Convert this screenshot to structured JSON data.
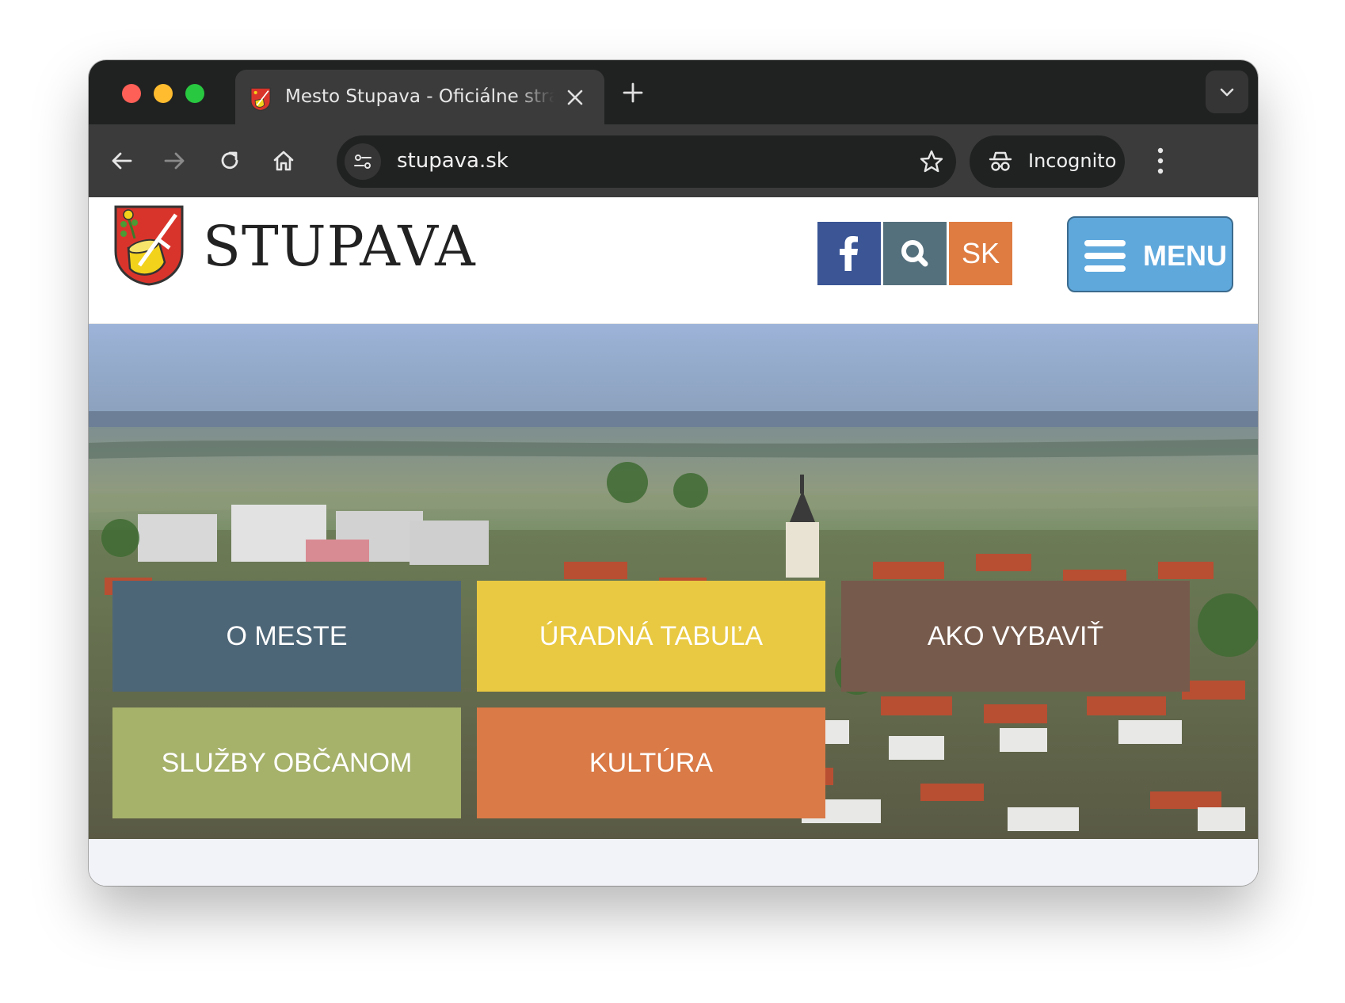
{
  "browser": {
    "tab_title": "Mesto Stupava - Oficiálne stránky mesta",
    "url": "stupava.sk",
    "incognito_label": "Incognito"
  },
  "site": {
    "logo_text": "STUPAVA",
    "lang_label": "SK",
    "menu_label": "MENU"
  },
  "tiles": {
    "o_meste": "O MESTE",
    "uradna_tabula": "ÚRADNÁ TABUĽA",
    "ako_vybavit": "AKO VYBAVIŤ",
    "sluzby_obcanom": "SLUŽBY OBČANOM",
    "kultura": "KULTÚRA"
  },
  "colors": {
    "facebook": "#3b5595",
    "search": "#55707d",
    "lang": "#de7c42",
    "menu": "#5fa8dc",
    "tile_o_meste": "#4d6677",
    "tile_uradna_tabula": "#e9c941",
    "tile_ako_vybavit": "#765a4b",
    "tile_sluzby_obcanom": "#a6b16a",
    "tile_kultura": "#d97a47"
  }
}
